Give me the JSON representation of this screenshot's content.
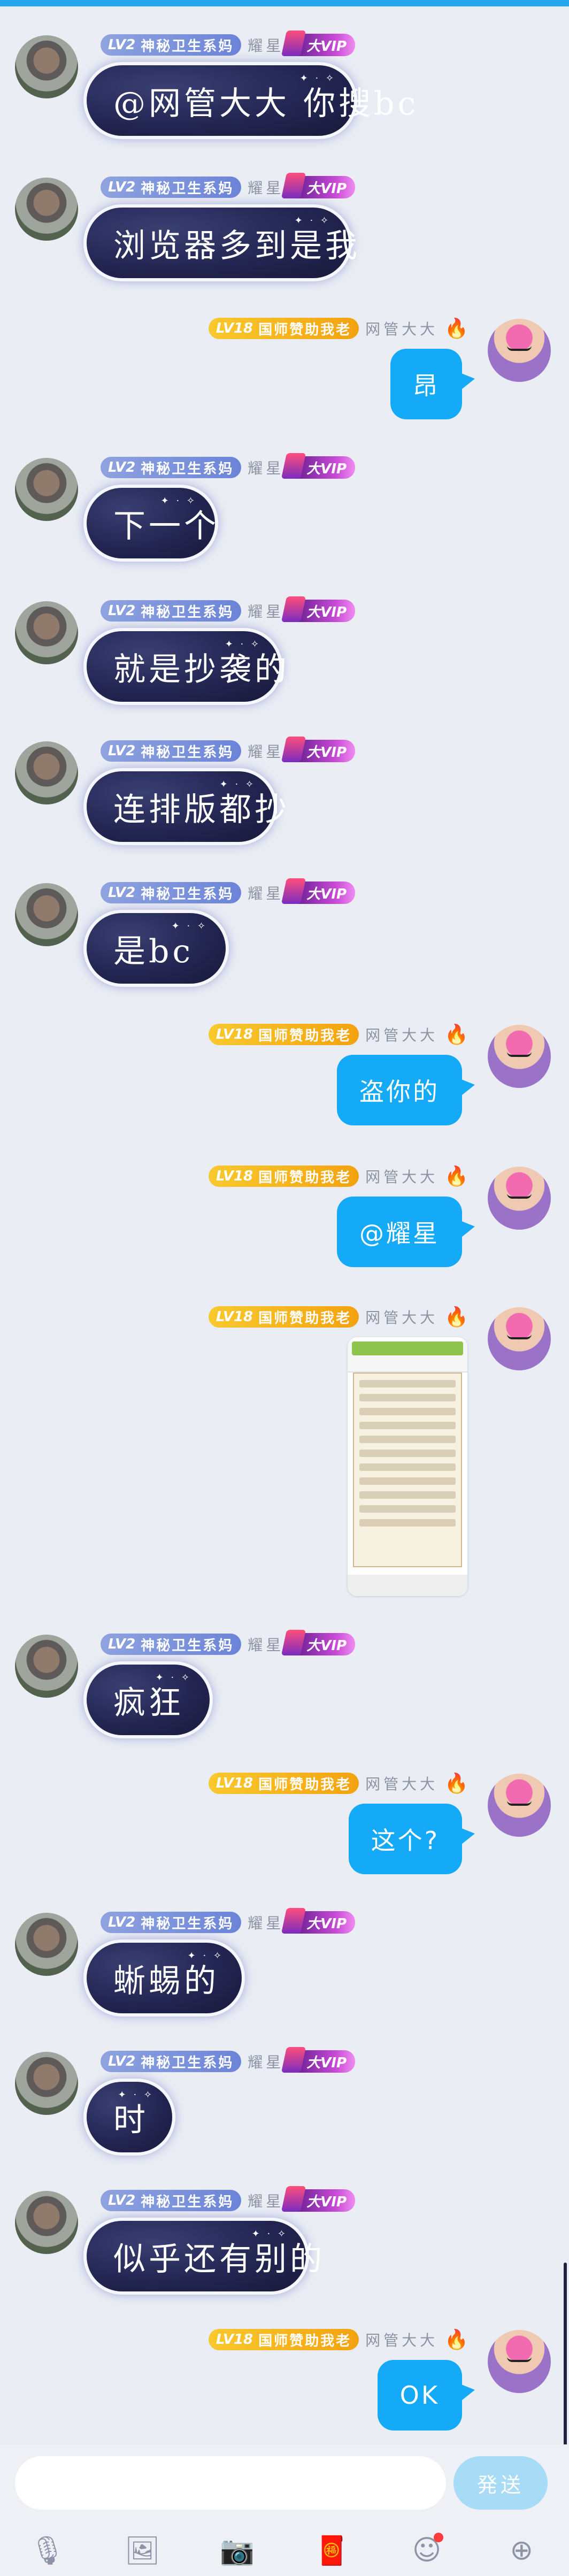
{
  "left_user": {
    "level": "LV2",
    "title": "神秘卫生系妈",
    "nick": "耀星",
    "badge": "大VIP"
  },
  "right_user": {
    "level": "LV18",
    "title": "国师赞助我老",
    "nick": "网管大大",
    "flame": "🔥"
  },
  "messages": [
    {
      "side": "left",
      "text": "@网管大大 你搜bc"
    },
    {
      "side": "left",
      "text": "浏览器多到是我"
    },
    {
      "side": "right",
      "text": "昂"
    },
    {
      "side": "left",
      "text": "下一个"
    },
    {
      "side": "left",
      "text": "就是抄袭的"
    },
    {
      "side": "left",
      "text": "连排版都抄"
    },
    {
      "side": "left",
      "text": "是bc"
    },
    {
      "side": "right",
      "text": "盗你的"
    },
    {
      "side": "right",
      "text": "@耀星"
    },
    {
      "side": "right",
      "image": "screenshot-image"
    },
    {
      "side": "left",
      "text": "疯狂"
    },
    {
      "side": "right",
      "text": "这个?"
    },
    {
      "side": "left",
      "text": "蜥蜴的"
    },
    {
      "side": "left",
      "text": "时"
    },
    {
      "side": "left",
      "text": "似乎还有别的"
    },
    {
      "side": "right",
      "text": "OK"
    }
  ],
  "input": {
    "placeholder": "",
    "send_label": "発送"
  },
  "toolbar": {
    "icons": [
      "microphone-icon",
      "image-icon",
      "camera-icon",
      "red-envelope-icon",
      "emoji-icon",
      "plus-icon"
    ]
  },
  "colors": {
    "accent": "#14aaf7",
    "background": "#eaedf4",
    "send_disabled": "#a8dcf6"
  }
}
